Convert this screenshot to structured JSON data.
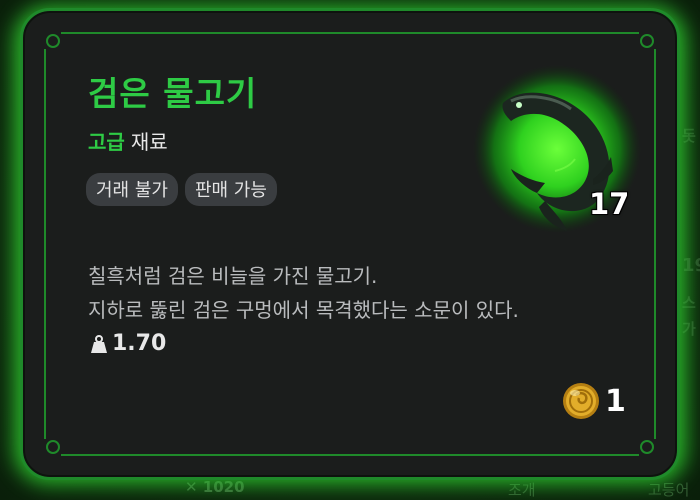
{
  "background": {
    "bottom_left_text": "✕ 1020",
    "bottom_mid_text": "조개",
    "bottom_right_text": "고등어",
    "right_fragments": [
      "돗",
      "19",
      "스",
      "가"
    ]
  },
  "item": {
    "name": "검은 물고기",
    "grade": "고급",
    "category": "재료",
    "tags": [
      "거래 불가",
      "판매 가능"
    ],
    "quantity": "17",
    "description": [
      "칠흑처럼 검은 비늘을 가진 물고기.",
      "지하로 뚫린 검은 구멍에서 목격했다는 소문이 있다."
    ],
    "weight": "1.70",
    "price": "1",
    "icons": {
      "item": "black-fish-icon",
      "weight": "weight-icon",
      "currency": "gold-coin-icon"
    }
  },
  "colors": {
    "accent": "#2ecb45",
    "frame": "#1f8a2a",
    "panel": "#1b1d1c",
    "tag_bg": "#3a3d40",
    "coin": "#d9a520"
  }
}
